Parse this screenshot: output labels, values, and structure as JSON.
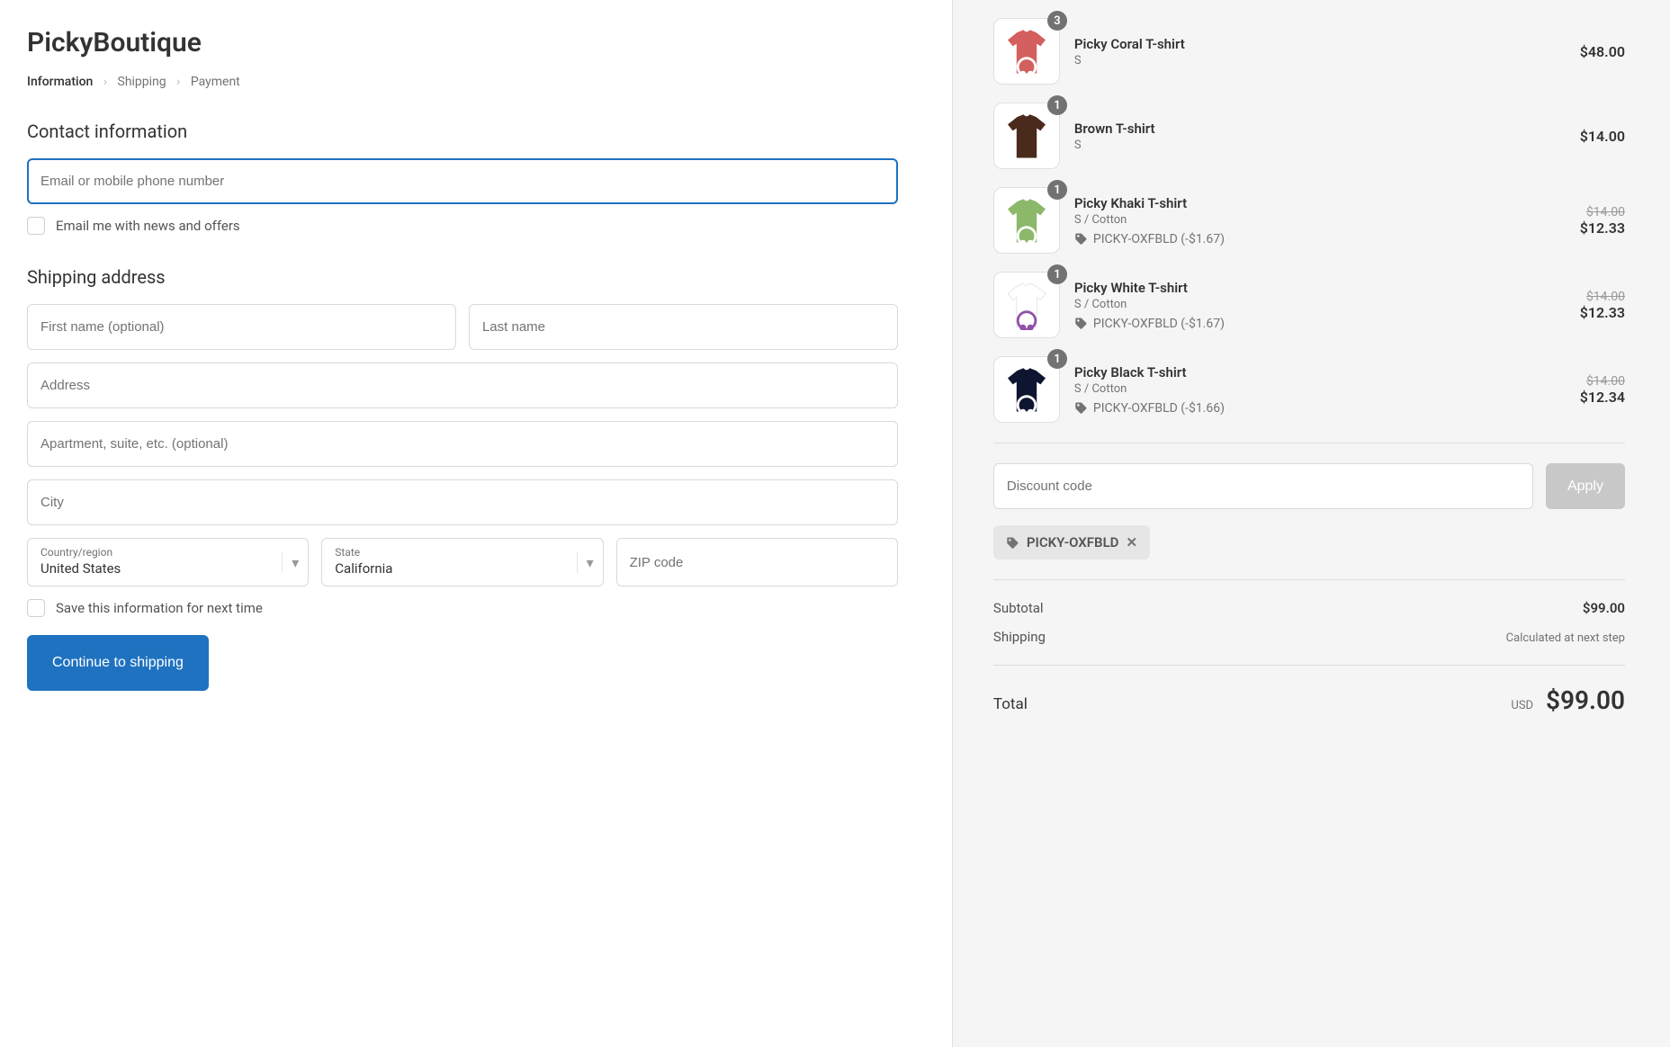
{
  "store": {
    "title": "PickyBoutique"
  },
  "breadcrumb": {
    "step1": "Information",
    "step2": "Shipping",
    "step3": "Payment"
  },
  "contact": {
    "heading": "Contact information",
    "email_placeholder": "Email or mobile phone number",
    "newsletter_label": "Email me with news and offers"
  },
  "shipping": {
    "heading": "Shipping address",
    "first_name_placeholder": "First name (optional)",
    "last_name_placeholder": "Last name",
    "address_placeholder": "Address",
    "apt_placeholder": "Apartment, suite, etc. (optional)",
    "city_placeholder": "City",
    "country_label": "Country/region",
    "country_value": "United States",
    "state_label": "State",
    "state_value": "California",
    "zip_placeholder": "ZIP code",
    "save_label": "Save this information for next time"
  },
  "actions": {
    "continue": "Continue to shipping"
  },
  "cart": {
    "items": [
      {
        "name": "Picky Coral T-shirt",
        "variant": "S",
        "qty": "3",
        "price": "$48.00",
        "color": "#d45f5f",
        "logo": true
      },
      {
        "name": "Brown T-shirt",
        "variant": "S",
        "qty": "1",
        "price": "$14.00",
        "color": "#4a2a1a",
        "logo": false
      },
      {
        "name": "Picky Khaki T-shirt",
        "variant": "S / Cotton",
        "qty": "1",
        "orig": "$14.00",
        "price": "$12.33",
        "discount": "PICKY-OXFBLD (-$1.67)",
        "color": "#8cb86a",
        "logo": true
      },
      {
        "name": "Picky White T-shirt",
        "variant": "S / Cotton",
        "qty": "1",
        "orig": "$14.00",
        "price": "$12.33",
        "discount": "PICKY-OXFBLD (-$1.67)",
        "color": "#ffffff",
        "logo": true,
        "logocolor": "#9050a8"
      },
      {
        "name": "Picky Black T-shirt",
        "variant": "S / Cotton",
        "qty": "1",
        "orig": "$14.00",
        "price": "$12.34",
        "discount": "PICKY-OXFBLD (-$1.66)",
        "color": "#0e1530",
        "logo": true
      }
    ],
    "discount_placeholder": "Discount code",
    "apply_label": "Apply",
    "applied_code": "PICKY-OXFBLD",
    "subtotal_label": "Subtotal",
    "subtotal_value": "$99.00",
    "shipping_label": "Shipping",
    "shipping_value": "Calculated at next step",
    "total_label": "Total",
    "currency": "USD",
    "total_value": "$99.00"
  }
}
